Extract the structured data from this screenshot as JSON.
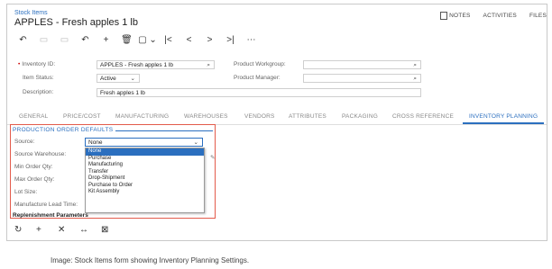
{
  "header": {
    "breadcrumb": "Stock Items",
    "title": "APPLES - Fresh apples 1 lb",
    "notes": "NOTES",
    "activities": "ACTIVITIES",
    "files": "FILES"
  },
  "toolbar": [
    "↶",
    "▭",
    "▭",
    "↶",
    "+",
    "🗑",
    "▢ ⌄",
    "|<",
    "<",
    ">",
    ">|",
    "⋯"
  ],
  "form": {
    "inventory_id_label": "Inventory ID:",
    "inventory_id_value": "APPLES - Fresh apples 1 lb",
    "item_status_label": "Item Status:",
    "item_status_value": "Active",
    "description_label": "Description:",
    "description_value": "Fresh apples 1 lb",
    "product_workgroup_label": "Product Workgroup:",
    "product_workgroup_value": "",
    "product_manager_label": "Product Manager:",
    "product_manager_value": ""
  },
  "tabs": [
    "GENERAL",
    "PRICE/COST",
    "MANUFACTURING",
    "WAREHOUSES",
    "VENDORS",
    "ATTRIBUTES",
    "PACKAGING",
    "CROSS REFERENCE",
    "INVENTORY PLANNING"
  ],
  "active_tab": "INVENTORY PLANNING",
  "section": {
    "title": "PRODUCTION ORDER DEFAULTS",
    "source_label": "Source:",
    "source_value": "None",
    "source_warehouse_label": "Source Warehouse:",
    "min_order_qty_label": "Min Order Qty:",
    "max_order_qty_label": "Max Order Qty:",
    "lot_size_label": "Lot Size:",
    "manufacture_lead_time_label": "Manufacture Lead Time:"
  },
  "dropdown_options": [
    "None",
    "Purchase",
    "Manufacturing",
    "Transfer",
    "Drop-Shipment",
    "Purchase to Order",
    "Kit Assembly"
  ],
  "dropdown_selected": "None",
  "replenishment": {
    "title": "Replenishment Parameters",
    "toolbar": [
      "↻",
      "+",
      "✕",
      "↔",
      "⊠"
    ]
  },
  "caption": "Image: Stock Items form showing Inventory Planning Settings.",
  "colors": {
    "accent": "#2b6fbf",
    "highlight_border": "#e35b4b"
  }
}
